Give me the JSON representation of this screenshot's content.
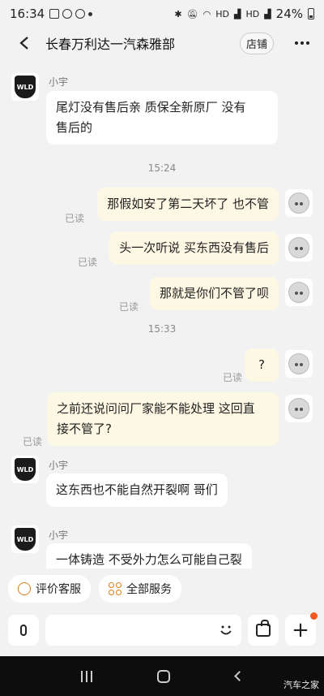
{
  "status_bar": {
    "time": "16:34",
    "signal_a": "HD",
    "signal_b": "HD",
    "battery": "24%"
  },
  "header": {
    "title": "长春万利达一汽森雅部",
    "shop_label": "店铺"
  },
  "messages": [
    {
      "side": "in",
      "sender": "小宇",
      "avatar_text": "WLD",
      "text_line1": "尾灯没有售后亲 质保全新原厂 没有",
      "text_line2": "售后的"
    },
    {
      "side": "time",
      "text": "15:24"
    },
    {
      "side": "out",
      "text": "那假如安了第二天坏了 也不管",
      "read": "已读"
    },
    {
      "side": "out",
      "text": "头一次听说 买东西没有售后",
      "read": "已读"
    },
    {
      "side": "out",
      "text": "那就是你们不管了呗",
      "read": "已读"
    },
    {
      "side": "time",
      "text": "15:33"
    },
    {
      "side": "out",
      "text": "?",
      "read": "已读"
    },
    {
      "side": "out",
      "text_line1": "之前还说问问厂家能不能处理 这回直",
      "text_line2": "接不管了?",
      "read": "已读"
    },
    {
      "side": "in",
      "sender": "小宇",
      "avatar_text": "WLD",
      "text": "这东西也不能自然开裂啊 哥们"
    },
    {
      "side": "in",
      "sender": "小宇",
      "avatar_text": "WLD",
      "text": "一体铸造 不受外力怎么可能自己裂"
    }
  ],
  "quick_actions": {
    "rate_service": "评价客服",
    "all_services": "全部服务"
  },
  "input": {
    "placeholder": ""
  },
  "watermark": "汽车之家",
  "colors": {
    "background": "#f2f2f2",
    "bubble_out": "#fdf8e4",
    "bubble_in": "#ffffff",
    "accent": "#e07b1a",
    "badge": "#f25a1f"
  }
}
